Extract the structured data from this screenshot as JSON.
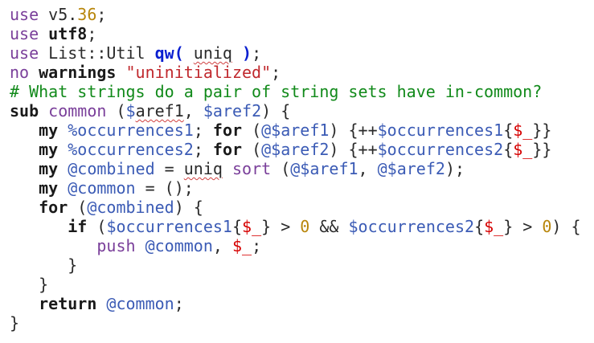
{
  "editor": {
    "lines": [
      [
        [
          "builtin",
          "use"
        ],
        [
          "plain",
          " v5."
        ],
        [
          "number",
          "36"
        ],
        [
          "plain",
          ";"
        ]
      ],
      [
        [
          "builtin",
          "use"
        ],
        [
          "plain",
          " "
        ],
        [
          "keyword",
          "utf8"
        ],
        [
          "plain",
          ";"
        ]
      ],
      [
        [
          "builtin",
          "use"
        ],
        [
          "plain",
          " List::Util "
        ],
        [
          "qw",
          "qw("
        ],
        [
          "plain",
          " "
        ],
        [
          "squiggle",
          "uniq"
        ],
        [
          "plain",
          " "
        ],
        [
          "qw",
          ")"
        ],
        [
          "plain",
          ";"
        ]
      ],
      [
        [
          "builtin",
          "no"
        ],
        [
          "plain",
          " "
        ],
        [
          "keyword",
          "warnings"
        ],
        [
          "plain",
          " "
        ],
        [
          "string",
          "\"uninitialized\""
        ],
        [
          "plain",
          ";"
        ]
      ],
      [
        [
          "comment",
          "# What strings do a pair of string sets have in-common?"
        ]
      ],
      [
        [
          "keyword",
          "sub"
        ],
        [
          "plain",
          " "
        ],
        [
          "builtin",
          "common"
        ],
        [
          "plain",
          " ("
        ],
        [
          "variable",
          "$"
        ],
        [
          "squiggle",
          "aref1"
        ],
        [
          "plain",
          ", "
        ],
        [
          "variable",
          "$aref2"
        ],
        [
          "plain",
          ") {"
        ]
      ],
      [
        [
          "plain",
          "   "
        ],
        [
          "keyword",
          "my"
        ],
        [
          "plain",
          " "
        ],
        [
          "variable",
          "%occurrences1"
        ],
        [
          "plain",
          "; "
        ],
        [
          "keyword",
          "for"
        ],
        [
          "plain",
          " ("
        ],
        [
          "variable",
          "@$aref1"
        ],
        [
          "plain",
          ") {++"
        ],
        [
          "variable",
          "$occurrences1"
        ],
        [
          "plain",
          "{"
        ],
        [
          "special",
          "$_"
        ],
        [
          "plain",
          "}}"
        ]
      ],
      [
        [
          "plain",
          "   "
        ],
        [
          "keyword",
          "my"
        ],
        [
          "plain",
          " "
        ],
        [
          "variable",
          "%occurrences2"
        ],
        [
          "plain",
          "; "
        ],
        [
          "keyword",
          "for"
        ],
        [
          "plain",
          " ("
        ],
        [
          "variable",
          "@$aref2"
        ],
        [
          "plain",
          ") {++"
        ],
        [
          "variable",
          "$occurrences2"
        ],
        [
          "plain",
          "{"
        ],
        [
          "special",
          "$_"
        ],
        [
          "plain",
          "}}"
        ]
      ],
      [
        [
          "plain",
          "   "
        ],
        [
          "keyword",
          "my"
        ],
        [
          "plain",
          " "
        ],
        [
          "variable",
          "@combined"
        ],
        [
          "plain",
          " = "
        ],
        [
          "squiggle",
          "uniq"
        ],
        [
          "plain",
          " "
        ],
        [
          "builtin",
          "sort"
        ],
        [
          "plain",
          " ("
        ],
        [
          "variable",
          "@$aref1"
        ],
        [
          "plain",
          ", "
        ],
        [
          "variable",
          "@$aref2"
        ],
        [
          "plain",
          ");"
        ]
      ],
      [
        [
          "plain",
          "   "
        ],
        [
          "keyword",
          "my"
        ],
        [
          "plain",
          " "
        ],
        [
          "variable",
          "@common"
        ],
        [
          "plain",
          " = ();"
        ]
      ],
      [
        [
          "plain",
          "   "
        ],
        [
          "keyword",
          "for"
        ],
        [
          "plain",
          " ("
        ],
        [
          "variable",
          "@combined"
        ],
        [
          "plain",
          ") {"
        ]
      ],
      [
        [
          "plain",
          "      "
        ],
        [
          "keyword",
          "if"
        ],
        [
          "plain",
          " ("
        ],
        [
          "variable",
          "$occurrences1"
        ],
        [
          "plain",
          "{"
        ],
        [
          "special",
          "$_"
        ],
        [
          "plain",
          "} > "
        ],
        [
          "number",
          "0"
        ],
        [
          "plain",
          " && "
        ],
        [
          "variable",
          "$occurrences2"
        ],
        [
          "plain",
          "{"
        ],
        [
          "special",
          "$_"
        ],
        [
          "plain",
          "} > "
        ],
        [
          "number",
          "0"
        ],
        [
          "plain",
          ") {"
        ]
      ],
      [
        [
          "plain",
          "         "
        ],
        [
          "builtin",
          "push"
        ],
        [
          "plain",
          " "
        ],
        [
          "variable",
          "@common"
        ],
        [
          "plain",
          ", "
        ],
        [
          "special",
          "$_"
        ],
        [
          "plain",
          ";"
        ]
      ],
      [
        [
          "plain",
          "      }"
        ]
      ],
      [
        [
          "plain",
          "   }"
        ]
      ],
      [
        [
          "plain",
          "   "
        ],
        [
          "keyword",
          "return"
        ],
        [
          "plain",
          " "
        ],
        [
          "variable",
          "@common"
        ],
        [
          "plain",
          ";"
        ]
      ],
      [
        [
          "plain",
          "}"
        ]
      ]
    ]
  },
  "colors": {
    "background": "#ffffff",
    "keyword": "#1a1a1a",
    "builtin": "#7a3f9a",
    "variable": "#3b5bb5",
    "special_variable": "#d60000",
    "string": "#c0282d",
    "number": "#b8860b",
    "comment": "#118a1a",
    "qw": "#0a1fd0",
    "squiggle": "#d04040"
  }
}
